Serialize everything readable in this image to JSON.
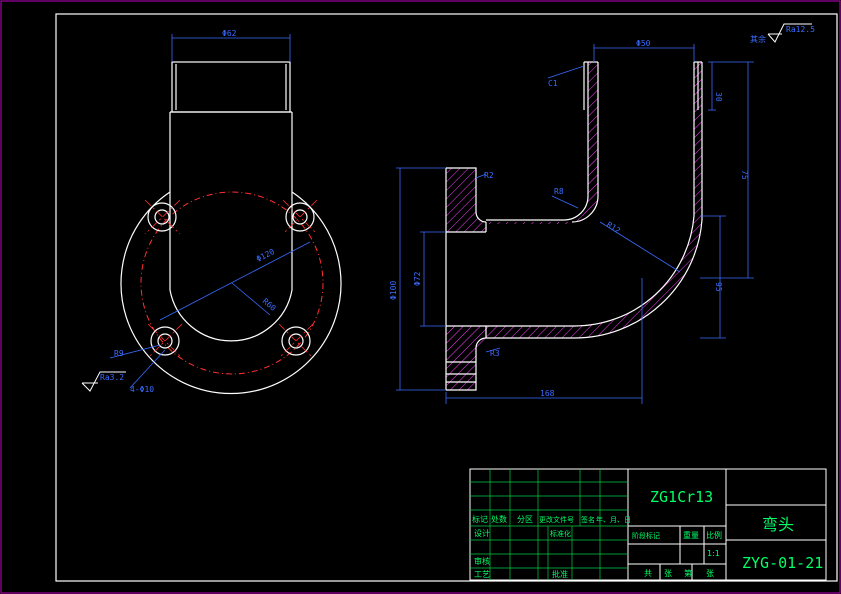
{
  "dims": {
    "phi_top_left": "Φ62",
    "phi_top_right": "Φ50",
    "c1": "C1",
    "r8": "R8",
    "r12": "R12",
    "phi72": "Φ72",
    "phi120": "Φ120",
    "phi100": "Φ100",
    "h30": "30",
    "h75": "75",
    "h95": "95",
    "h168": "168",
    "r9": "R9",
    "r60": "R60",
    "r3": "R3",
    "bolt": "4-Φ10",
    "ra_top": "Ra12.5",
    "ra_bottom": "Ra3.2",
    "qita": "其余",
    "r2": "R2"
  },
  "title_block": {
    "material": "ZG1Cr13",
    "part_name": "弯头",
    "drawing_no": "ZYG-01-21",
    "col_biaoji": "标记",
    "col_chushu": "处数",
    "col_fenqu": "分区",
    "col_genggai": "更改文件号",
    "col_qianming": "签名",
    "col_date": "年、月、日",
    "sheji": "设计",
    "biaozhunhua": "标准化",
    "shenhe": "审核",
    "gongyi": "工艺",
    "pizhun": "批准",
    "jieduan": "阶段标记",
    "zhongliang": "重量",
    "bili": "比例",
    "scale": "1:1",
    "gong": "共",
    "zhang1": "张",
    "di": "第",
    "zhang2": "张"
  }
}
